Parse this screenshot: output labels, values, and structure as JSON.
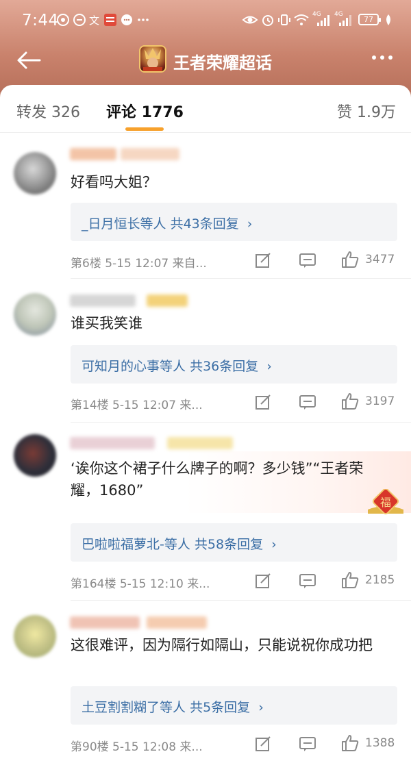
{
  "status_bar": {
    "time": "7:44",
    "battery": "77",
    "net1": "4G",
    "net2": "4G"
  },
  "nav": {
    "title": "王者荣耀超话"
  },
  "tabs": {
    "repost": "转发 326",
    "comment": "评论 1776",
    "like": "赞 1.9万"
  },
  "comments": [
    {
      "text": "好看吗大姐？",
      "replies_user": "_日月恒长等人",
      "replies_count": "共43条回复",
      "arrow": "›",
      "meta": "第6楼  5-15 12:07  来自...",
      "likes": "3477"
    },
    {
      "text": "谁买我笑谁",
      "replies_user": "可知月的心事等人",
      "replies_count": "共36条回复",
      "arrow": "›",
      "meta": "第14楼  5-15 12:07  来...",
      "likes": "3197"
    },
    {
      "text": "‘诶你这个裙子什么牌子的啊？多少钱”“王者荣耀，1680”",
      "replies_user": "巴啦啦福萝北-等人",
      "replies_count": "共58条回复",
      "arrow": "›",
      "meta": "第164楼  5-15 12:10  来...",
      "likes": "2185",
      "decoration": "福"
    },
    {
      "text": "这很难评，因为隔行如隔山，只能说祝你成功把",
      "replies_user": "土豆割割糊了等人",
      "replies_count": "共5条回复",
      "arrow": "›",
      "meta": "第90楼  5-15 12:08  来...",
      "likes": "1388"
    }
  ]
}
